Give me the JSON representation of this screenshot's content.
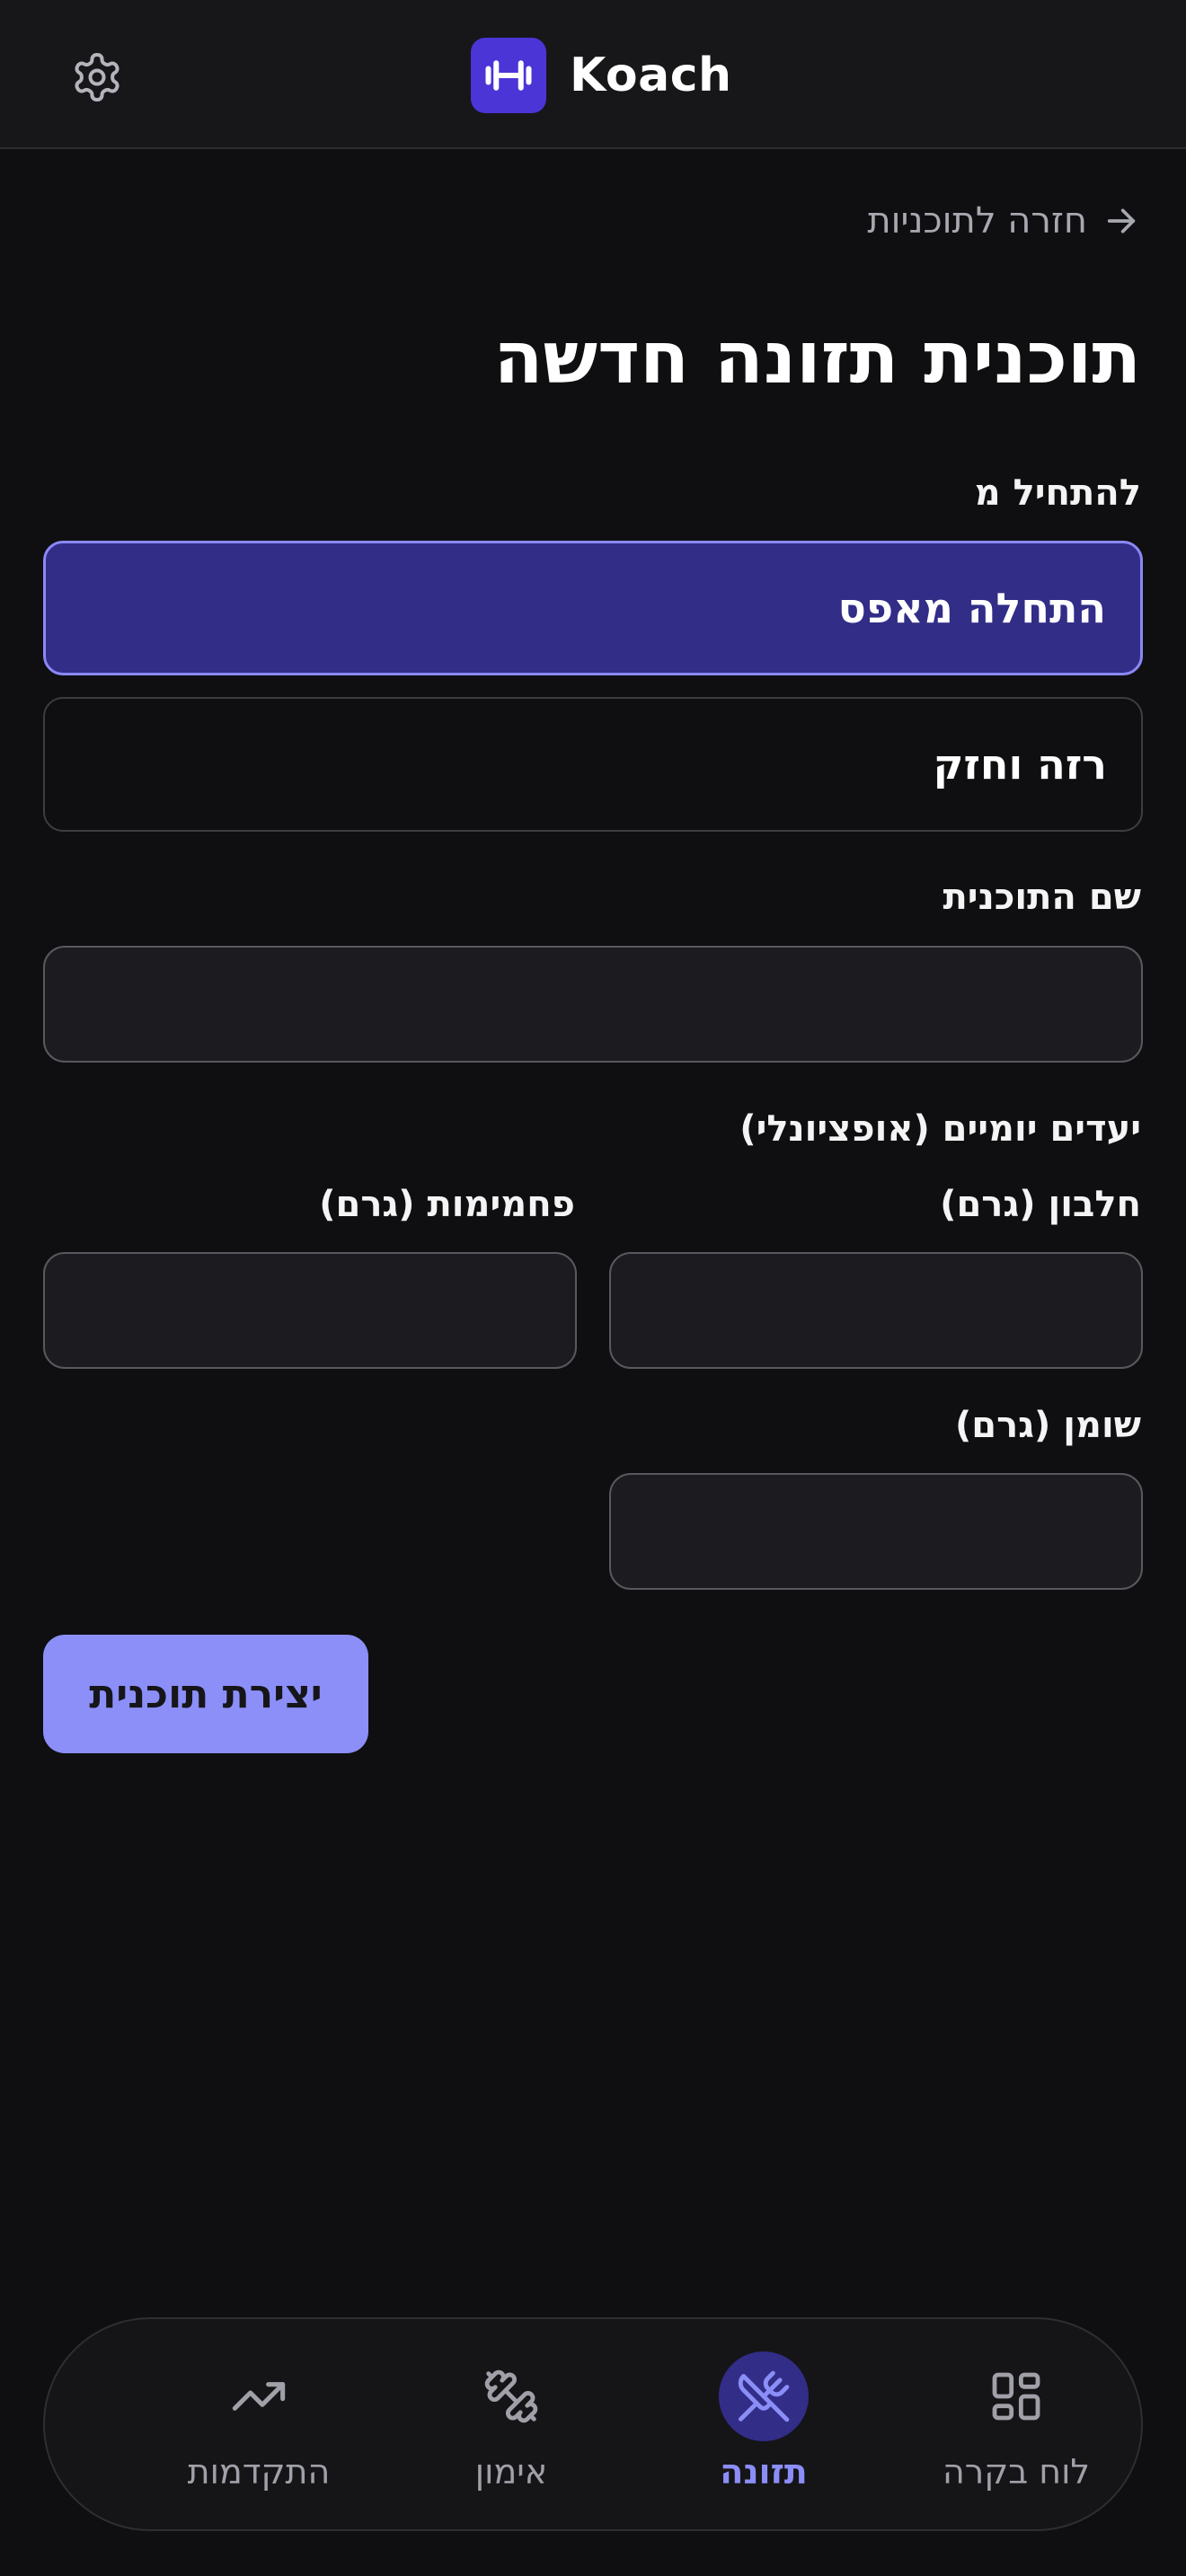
{
  "header": {
    "app_name": "Koach",
    "settings_icon": "gear-icon",
    "logo_icon": "dumbbell-icon"
  },
  "back_link": {
    "label": "חזרה לתוכניות",
    "icon": "arrow-right-icon"
  },
  "page_title": "תוכנית תזונה חדשה",
  "start_from": {
    "label": "להתחיל מ",
    "options": [
      {
        "label": "התחלה מאפס",
        "selected": true
      },
      {
        "label": "רזה וחזק",
        "selected": false
      }
    ]
  },
  "plan_name": {
    "label": "שם התוכנית",
    "value": "",
    "placeholder": ""
  },
  "daily_goals": {
    "label": "יעדים יומיים (אופציונלי)",
    "protein": {
      "label": "חלבון (גרם)",
      "value": ""
    },
    "carbs": {
      "label": "פחמימות (גרם)",
      "value": ""
    },
    "fat": {
      "label": "שומן (גרם)",
      "value": ""
    }
  },
  "create_button": {
    "label": "יצירת תוכנית"
  },
  "bottom_nav": {
    "items": [
      {
        "label": "לוח בקרה",
        "icon": "dashboard-grid-icon",
        "active": false
      },
      {
        "label": "תזונה",
        "icon": "fork-knife-icon",
        "active": true
      },
      {
        "label": "אימון",
        "icon": "dumbbell-icon",
        "active": false
      },
      {
        "label": "התקדמות",
        "icon": "trending-up-icon",
        "active": false
      }
    ]
  },
  "colors": {
    "background": "#0f0f11",
    "accent": "#8b8ef7",
    "selected_fill": "#322d87",
    "logo_bg": "#4b35d6"
  }
}
